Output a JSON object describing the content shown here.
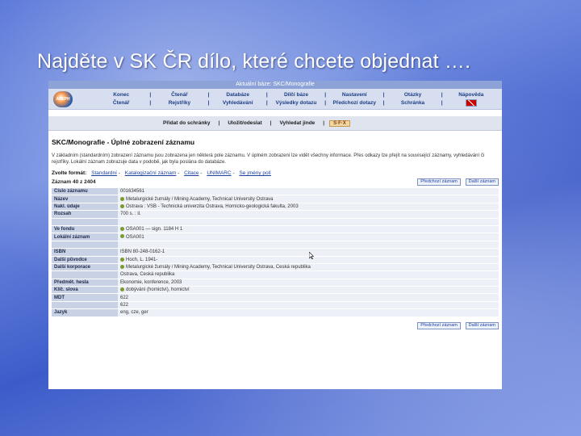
{
  "slide": {
    "title": "Najděte v SK ČR dílo, které chcete objednat …."
  },
  "app": {
    "base_label": "Aktuální báze: SKC/Monografie",
    "logo_text": "ALEPH",
    "menu": {
      "row1": [
        "Konec",
        "Čtenář",
        "Databáze",
        "Dílčí báze",
        "Nastavení",
        "Otázky",
        "Nápověda"
      ],
      "row2": [
        "Čtenář",
        "Rejstříky",
        "Vyhledávání",
        "Výsledky dotazu",
        "Předchozí dotazy",
        "Schránka",
        ""
      ]
    },
    "toolbar": {
      "add": "Přidat do schránky",
      "save": "Uložit/odeslat",
      "request": "Vyhledat jinde",
      "sfx": "S·F·X"
    },
    "record": {
      "title": "SKC/Monografie - Úplné zobrazení záznamu",
      "intro": "V základním (standardním) zobrazení záznamu jsou zobrazena jen některá pole záznamu. V úplném zobrazení lze vidět všechny informace. Přes odkazy lze přejít na související záznamy, vyhledávání či rejstříky. Lokální záznam zobrazuje data v podobě, jak byla poslána do databáze.",
      "format_label": "Zvolte formát:",
      "formats": [
        "Standardní",
        "Katalogizační záznam",
        "Citace",
        "UNIMARC",
        "Se jmény polí"
      ],
      "position": "Záznam 40 z 2404",
      "prev_button": "Předchozí záznam",
      "next_button": "Další záznam",
      "rows": [
        {
          "label": "Číslo záznamu",
          "value": "001634561",
          "bullet": false
        },
        {
          "label": "Název",
          "value": "Metalurgické žurnály / Mining Academy, Technical University Ostrava",
          "bullet": true
        },
        {
          "label": "Nakl. údaje",
          "value": "Ostrava : VŠB - Technická univerzita Ostrava, Hornicko-geologická fakulta, 2003",
          "bullet": true
        },
        {
          "label": "Rozsah",
          "value": "700 s. : il.",
          "bullet": false
        },
        {
          "label": "",
          "value": "",
          "bullet": false
        },
        {
          "label": "Ve fondu",
          "value": "OSA001 — sign. 1184 H 1",
          "bullet": true
        },
        {
          "label": "Lokální záznam",
          "value": "OSA001",
          "bullet": true
        },
        {
          "label": "",
          "value": "",
          "bullet": false
        },
        {
          "label": "ISBN",
          "value": "ISBN 80-248-0162-1",
          "bullet": false
        },
        {
          "label": "Další původce",
          "value": "Hoch, L. 1941-",
          "bullet": true
        },
        {
          "label": "Další korporace",
          "value": "Metalurgické žurnály / Mining Academy, Technical University Ostrava, Česká republika",
          "bullet": true
        },
        {
          "label": "",
          "value": "Ostrava, Česká republika",
          "bullet": false
        },
        {
          "label": "Předmět. hesla",
          "value": "Ekonomie, konference, 2003",
          "bullet": false
        },
        {
          "label": "Klíč. slova",
          "value": "dobývání (hornictví), hornictví",
          "bullet": true
        },
        {
          "label": "MDT",
          "value": "622",
          "bullet": false
        },
        {
          "label": "",
          "value": "622",
          "bullet": false
        },
        {
          "label": "Jazyk",
          "value": "eng, cze, ger",
          "bullet": false
        }
      ]
    }
  }
}
